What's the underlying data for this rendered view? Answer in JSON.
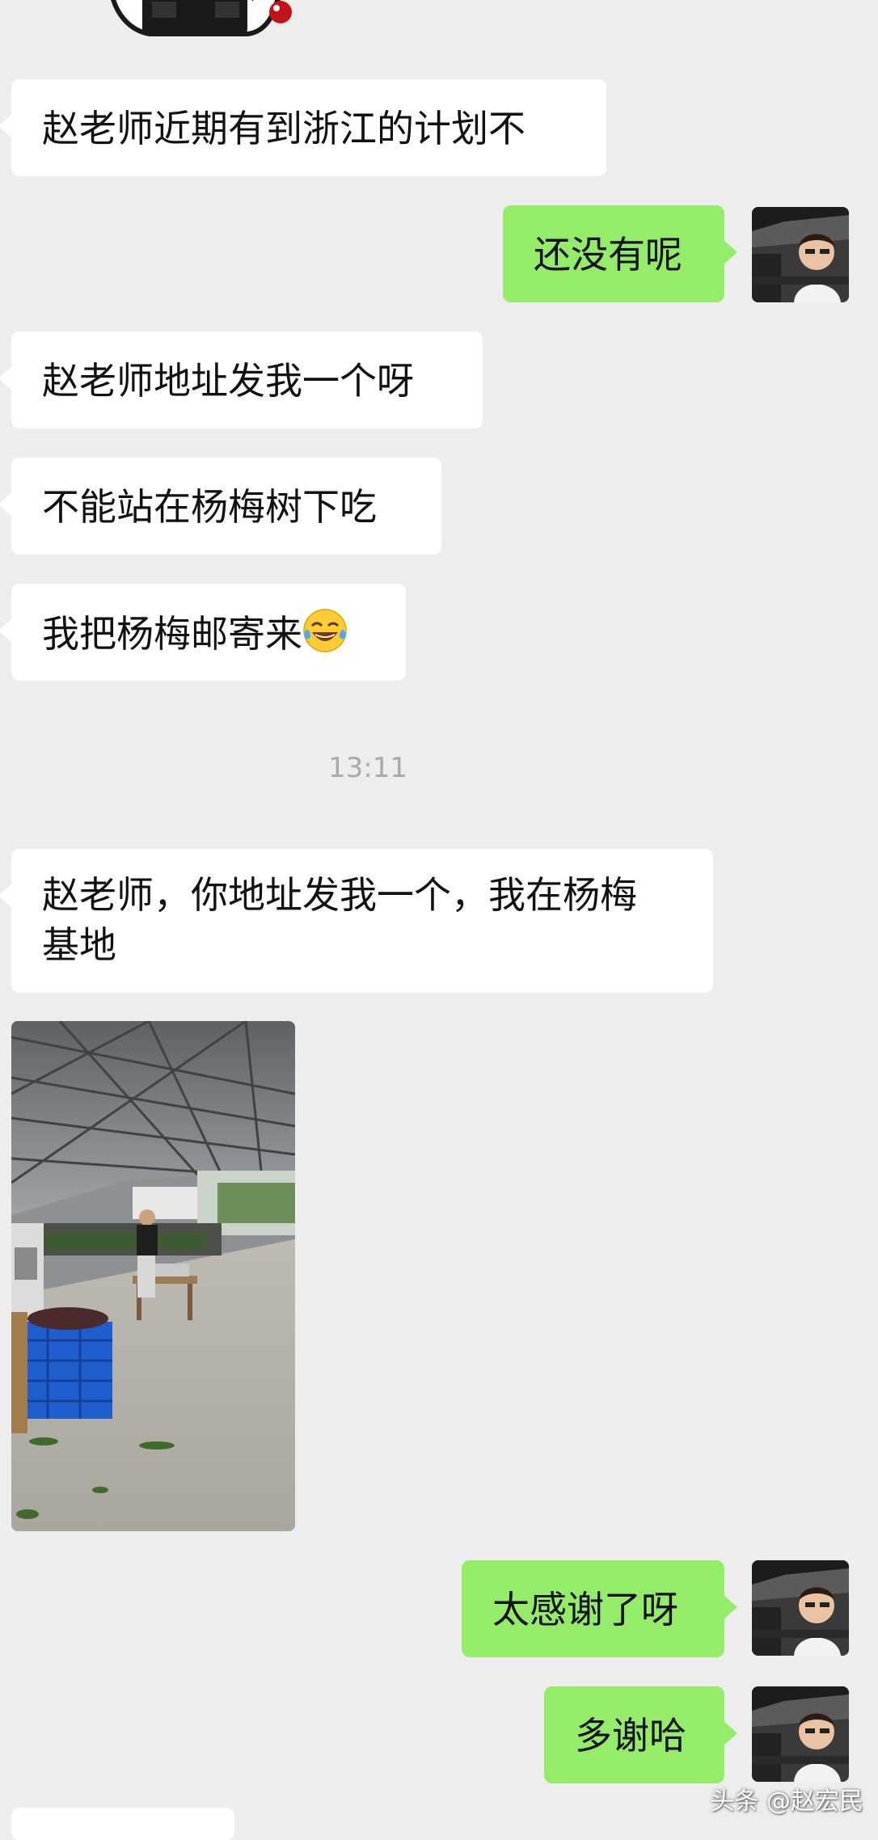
{
  "messages": [
    {
      "side": "left",
      "text": "赵老师近期有到浙江的计划不"
    },
    {
      "side": "right",
      "text": "还没有呢"
    },
    {
      "side": "left",
      "text": "赵老师地址发我一个呀"
    },
    {
      "side": "left",
      "text": "不能站在杨梅树下吃"
    },
    {
      "side": "left",
      "text": "我把杨梅邮寄来",
      "emoji": "laughing-tears-icon"
    },
    {
      "side": "left",
      "text_line1": "赵老师，你地址发我一个，我在杨梅",
      "text_line2": "基地"
    },
    {
      "side": "left",
      "type": "image",
      "content": "photo-shed-market"
    },
    {
      "side": "right",
      "text": "太感谢了呀"
    },
    {
      "side": "right",
      "text": "多谢哈"
    }
  ],
  "timestamp": "13:11",
  "watermark": "头条 @赵宏民",
  "colors": {
    "background": "#ededed",
    "left_bubble": "#ffffff",
    "right_bubble": "#95ec69",
    "timestamp_text": "#a9a9a9"
  }
}
